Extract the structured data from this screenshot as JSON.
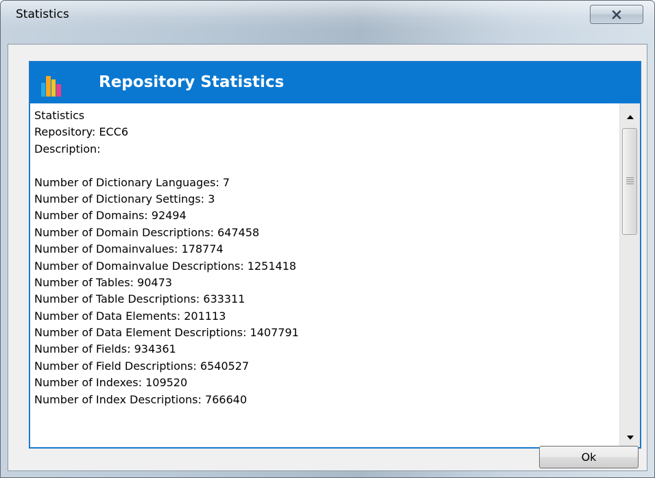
{
  "window": {
    "title": "Statistics",
    "close_icon": "close-x-icon"
  },
  "header": {
    "title": "Repository Statistics",
    "icon": "bar-chart-icon",
    "accent_color": "#0a78d0"
  },
  "stats_text": {
    "lines": [
      "Statistics",
      "Repository: ECC6",
      "Description:",
      "",
      "Number of Dictionary Languages: 7",
      "Number of Dictionary Settings: 3",
      "Number of Domains: 92494",
      "Number of Domain Descriptions: 647458",
      "Number of Domainvalues: 178774",
      "Number of Domainvalue Descriptions: 1251418",
      "Number of Tables: 90473",
      "Number of Table Descriptions: 633311",
      "Number of Data Elements: 201113",
      "Number of Data Element Descriptions: 1407791",
      "Number of Fields: 934361",
      "Number of Field Descriptions: 6540527",
      "Number of Indexes: 109520",
      "Number of Index Descriptions: 766640"
    ]
  },
  "scrollbar": {
    "up_icon": "scroll-up-arrow-icon",
    "down_icon": "scroll-down-arrow-icon"
  },
  "buttons": {
    "ok_label": "Ok"
  }
}
